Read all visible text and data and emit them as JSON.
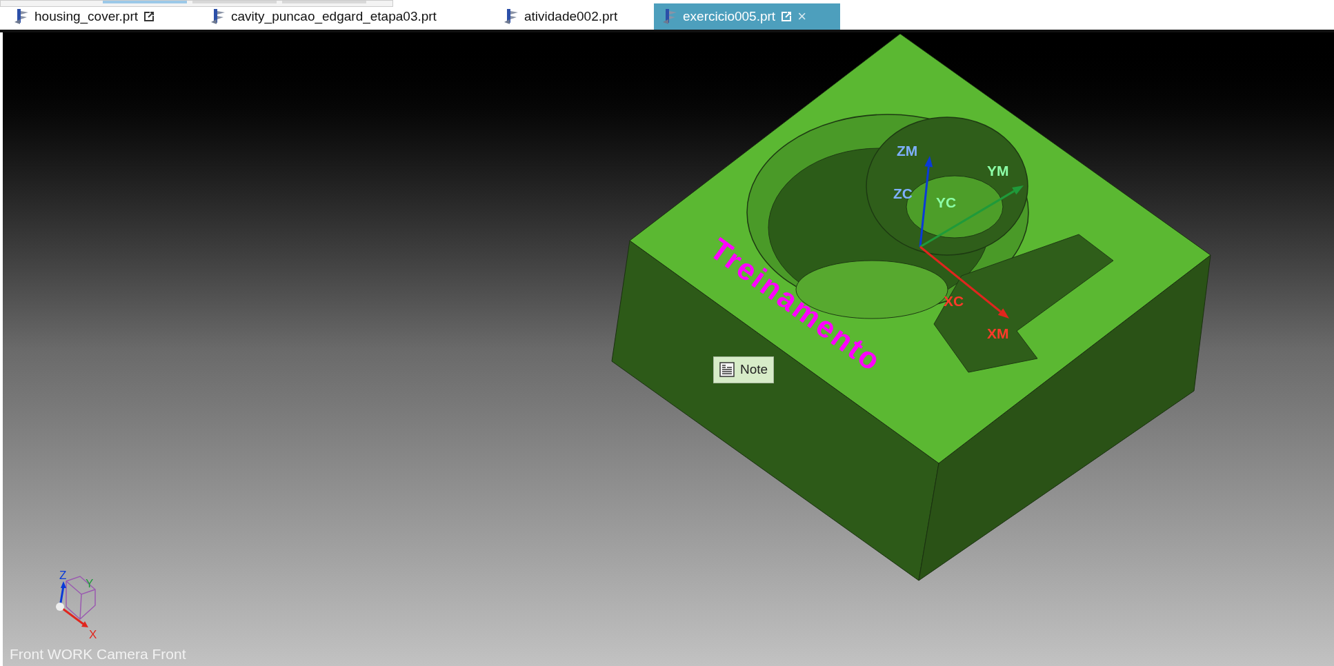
{
  "tabs": [
    {
      "label": "housing_cover.prt",
      "selected": false,
      "popout": true,
      "closable": false
    },
    {
      "label": "cavity_puncao_edgard_etapa03.prt",
      "selected": false,
      "popout": false,
      "closable": false
    },
    {
      "label": "atividade002.prt",
      "selected": false,
      "popout": false,
      "closable": false
    },
    {
      "label": "exercicio005.prt",
      "selected": true,
      "popout": true,
      "closable": true,
      "close_glyph": "×"
    }
  ],
  "viewport": {
    "annotation": "Treinamento",
    "tooltip": "Note",
    "csys_labels": [
      {
        "text": "ZM",
        "kind": "z"
      },
      {
        "text": "ZC",
        "kind": "z"
      },
      {
        "text": "YM",
        "kind": "y"
      },
      {
        "text": "YC",
        "kind": "y"
      },
      {
        "text": "XC",
        "kind": "x"
      },
      {
        "text": "XM",
        "kind": "x"
      }
    ],
    "triad_labels": [
      {
        "text": "Z",
        "kind": "z"
      },
      {
        "text": "Y",
        "kind": "y"
      },
      {
        "text": "X",
        "kind": "x"
      }
    ],
    "view_caption": "Front WORK Camera Front"
  }
}
